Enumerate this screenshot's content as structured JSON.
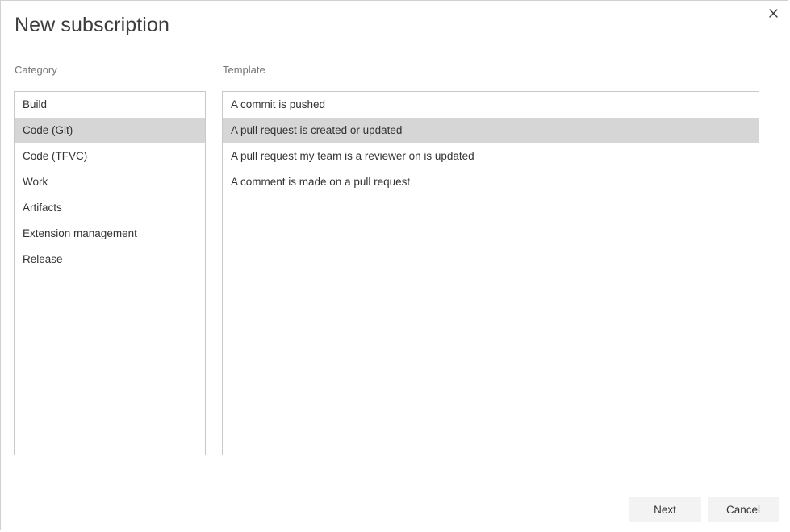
{
  "dialog": {
    "title": "New subscription",
    "close_icon": "close-icon"
  },
  "category": {
    "label": "Category",
    "items": [
      {
        "label": "Build",
        "selected": false
      },
      {
        "label": "Code (Git)",
        "selected": true
      },
      {
        "label": "Code (TFVC)",
        "selected": false
      },
      {
        "label": "Work",
        "selected": false
      },
      {
        "label": "Artifacts",
        "selected": false
      },
      {
        "label": "Extension management",
        "selected": false
      },
      {
        "label": "Release",
        "selected": false
      }
    ]
  },
  "template": {
    "label": "Template",
    "items": [
      {
        "label": "A commit is pushed",
        "selected": false
      },
      {
        "label": "A pull request is created or updated",
        "selected": true
      },
      {
        "label": "A pull request my team is a reviewer on is updated",
        "selected": false
      },
      {
        "label": "A comment is made on a pull request",
        "selected": false
      }
    ]
  },
  "footer": {
    "next_label": "Next",
    "cancel_label": "Cancel"
  },
  "colors": {
    "selection": "#d6d6d6",
    "border": "#c8c8c8",
    "text": "#333333",
    "muted_text": "#767676",
    "button_bg": "#f3f3f3"
  }
}
